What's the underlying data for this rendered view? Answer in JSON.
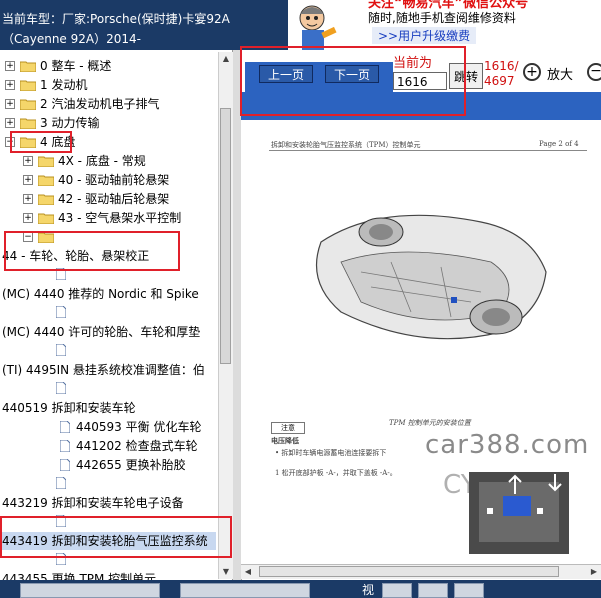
{
  "header": {
    "line1": "当前车型：厂家:Porsche(保时捷)卡宴92A",
    "line2": "（Cayenne 92A）2014-"
  },
  "banner": {
    "headline": "关注“畅易汽车”微信公众号",
    "subline": "随时,随地手机查阅维修资料",
    "link": ">>用户升级缴费"
  },
  "tree": {
    "items": [
      {
        "label": "0 整车 - 概述"
      },
      {
        "label": "1 发动机"
      },
      {
        "label": "2 汽油发动机电子排气"
      },
      {
        "label": "3 动力传输"
      },
      {
        "label": "4 底盘"
      },
      {
        "label": "4X - 底盘 - 常规"
      },
      {
        "label": "40 - 驱动轴前轮悬架"
      },
      {
        "label": "42 - 驱动轴后轮悬架"
      },
      {
        "label": "43 - 空气悬架水平控制"
      },
      {
        "label": "44 - 车轮、轮胎、悬架校正"
      },
      {
        "label": "(MC) 4440 推荐的 Nordic 和 Spike"
      },
      {
        "label": "(MC) 4440 许可的轮胎、车轮和厚垫"
      },
      {
        "label": "(TI) 4495IN 悬挂系统校准调整值：伯"
      },
      {
        "label": "440519 拆卸和安装车轮"
      },
      {
        "label": "440593 平衡 优化车轮"
      },
      {
        "label": "441202 检查盘式车轮"
      },
      {
        "label": "442655 更换补胎胶"
      },
      {
        "label": "443219 拆卸和安装车轮电子设备"
      },
      {
        "label": "443419 拆卸和安装轮胎气压监控系统"
      },
      {
        "label": "443455 更换 TPM 控制单元"
      }
    ]
  },
  "toolbar": {
    "prev_label": "上一页",
    "next_label": "下一页",
    "current_label": "当前为",
    "page_value": "1616",
    "go_label": "跳转",
    "page_count": "1616/\n4697",
    "zoom_in_label": "放大"
  },
  "document": {
    "header_left": "拆卸和安装轮胎气压监控系统（TPM）控制单元",
    "header_right": "Page 2 of 4",
    "caption": "TPM 控制单元的安装位置",
    "warn_label": "注意",
    "text1": "电压降低",
    "text2": "• 拆卸时车辆电源蓄电池连接要拆下",
    "text3": "1   松开底部护板 -A-，并取下盖板 -A-。",
    "watermark1": "car388.com",
    "watermark2": "CY2010"
  },
  "bottom": {
    "view_label": "视"
  },
  "colors": {
    "header_bg": "#1b3a66",
    "accent_blue": "#2c63c0",
    "highlight_red": "#e0202a",
    "page_red": "#d01010"
  }
}
